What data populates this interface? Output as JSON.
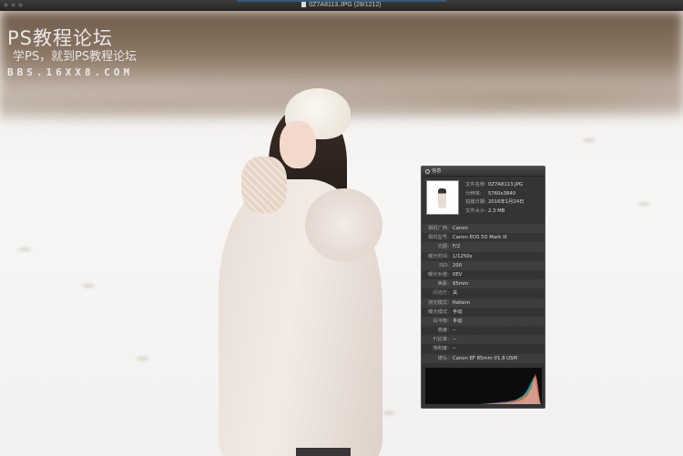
{
  "window": {
    "title": "0Z7A8113.JPG (28/1212)"
  },
  "watermark": {
    "title": "PS教程论坛",
    "subtitle": "学PS，就到PS教程论坛",
    "url": "BBS.16XX8.COM"
  },
  "info_panel": {
    "header": "信息",
    "file": {
      "name_label": "文件名称:",
      "name": "0Z7A8113.JPG",
      "resolution_label": "分辨率:",
      "resolution": "5760x3840",
      "date_label": "拍摄日期:",
      "date": "2016年1月24日",
      "size_label": "文件大小:",
      "size": "2.3 MB"
    },
    "rows": [
      {
        "label": "相机厂商:",
        "value": "Canon"
      },
      {
        "label": "相机型号:",
        "value": "Canon EOS 5D Mark III"
      },
      {
        "label": "光圈:",
        "value": "F/2"
      },
      {
        "label": "曝光时间:",
        "value": "1/1250s"
      },
      {
        "label": "ISO:",
        "value": "200"
      },
      {
        "label": "曝光补偿:",
        "value": "0EV"
      },
      {
        "label": "焦距:",
        "value": "85mm"
      },
      {
        "label": "闪光灯:",
        "value": "关"
      },
      {
        "label": "测光模式:",
        "value": "Pattern"
      },
      {
        "label": "曝光模式:",
        "value": "手动"
      },
      {
        "label": "白平衡:",
        "value": "手动"
      },
      {
        "label": "亮度:",
        "value": "--"
      },
      {
        "label": "F/比率:",
        "value": "--"
      },
      {
        "label": "饱和度:",
        "value": "--"
      },
      {
        "label": "镜头:",
        "value": "Canon EF 85mm f/1.8 USM"
      }
    ],
    "histogram_icon": "rgb-histogram"
  }
}
